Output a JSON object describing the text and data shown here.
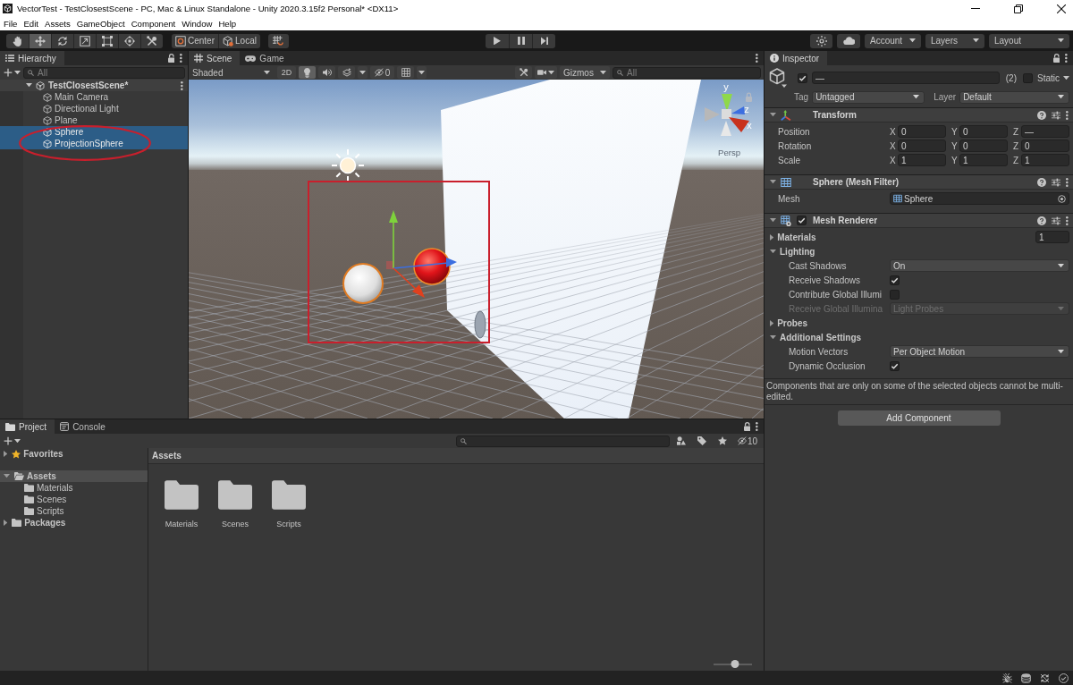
{
  "window": {
    "title": "VectorTest - TestClosestScene - PC, Mac & Linux Standalone - Unity 2020.3.15f2 Personal* <DX11>"
  },
  "menu": [
    "File",
    "Edit",
    "Assets",
    "GameObject",
    "Component",
    "Window",
    "Help"
  ],
  "toolbar": {
    "tools": [
      {
        "kind": "hand",
        "selected": false
      },
      {
        "kind": "move",
        "selected": true
      },
      {
        "kind": "rotate",
        "selected": false
      },
      {
        "kind": "scale",
        "selected": false
      },
      {
        "kind": "rect",
        "selected": false
      },
      {
        "kind": "transform",
        "selected": false
      },
      {
        "kind": "custom",
        "selected": false
      }
    ],
    "handles": [
      {
        "kind": "pivot",
        "label": "Center"
      },
      {
        "kind": "space",
        "label": "Local"
      }
    ],
    "menus": [
      "Account",
      "Layers",
      "Layout"
    ]
  },
  "hierarchy": {
    "tab": "Hierarchy",
    "search": {
      "placeholder": "All"
    },
    "scene": {
      "name": "TestClosestScene*",
      "expanded": true,
      "children": [
        {
          "name": "Main Camera",
          "selected": false
        },
        {
          "name": "Directional Light",
          "selected": false
        },
        {
          "name": "Plane",
          "selected": false
        },
        {
          "name": "Sphere",
          "selected": true
        },
        {
          "name": "ProjectionSphere",
          "selected": true
        }
      ]
    }
  },
  "scene_view": {
    "tabs": [
      {
        "kind": "scene",
        "label": "Scene",
        "selected": true
      },
      {
        "kind": "game",
        "label": "Game",
        "selected": false
      }
    ],
    "draw_mode": "Shaded",
    "mode_2d": {
      "label": "2D",
      "on": false
    },
    "toggles": [
      {
        "kind": "lighting",
        "on": true
      },
      {
        "kind": "audio",
        "on": false
      },
      {
        "kind": "effects",
        "on": false
      }
    ],
    "hidden_count": "0",
    "gizmos": "Gizmos",
    "search": {
      "placeholder": "All"
    },
    "axis_labels": [
      "y",
      "z",
      "x"
    ],
    "projection": "Persp"
  },
  "inspector": {
    "tab": "Inspector",
    "object": {
      "active": true,
      "name": "—",
      "count": "(2)",
      "static": false,
      "static_label": "Static",
      "tag_label": "Tag",
      "tag": "Untagged",
      "layer_label": "Layer",
      "layer": "Default"
    },
    "components": [
      {
        "kind": "transform",
        "title": "Transform",
        "expanded": true,
        "rows": [
          {
            "kind": "vector3",
            "label": "Position",
            "values": [
              {
                "axis": "X",
                "value": "0"
              },
              {
                "axis": "Y",
                "value": "0"
              },
              {
                "axis": "Z",
                "value": "—"
              }
            ]
          },
          {
            "kind": "vector3",
            "label": "Rotation",
            "values": [
              {
                "axis": "X",
                "value": "0"
              },
              {
                "axis": "Y",
                "value": "0"
              },
              {
                "axis": "Z",
                "value": "0"
              }
            ]
          },
          {
            "kind": "vector3",
            "label": "Scale",
            "values": [
              {
                "axis": "X",
                "value": "1"
              },
              {
                "axis": "Y",
                "value": "1"
              },
              {
                "axis": "Z",
                "value": "1"
              }
            ]
          }
        ]
      },
      {
        "kind": "mesh_filter",
        "title": "Sphere (Mesh Filter)",
        "expanded": true,
        "rows": [
          {
            "kind": "object",
            "label": "Mesh",
            "value": "Sphere"
          }
        ]
      },
      {
        "kind": "mesh_renderer",
        "title": "Mesh Renderer",
        "expanded": true,
        "enabled": true,
        "rows": [
          {
            "kind": "foldout",
            "label": "Materials",
            "expanded": false,
            "count": "1"
          },
          {
            "kind": "foldout",
            "label": "Lighting",
            "expanded": true,
            "rows": [
              {
                "kind": "dropdown",
                "label": "Cast Shadows",
                "value": "On",
                "disabled": false
              },
              {
                "kind": "checkbox",
                "label": "Receive Shadows",
                "checked": true,
                "disabled": false
              },
              {
                "kind": "checkbox",
                "label": "Contribute Global Illumi",
                "checked": false,
                "disabled": false
              },
              {
                "kind": "dropdown",
                "label": "Receive Global Illumina",
                "value": "Light Probes",
                "disabled": true
              }
            ]
          },
          {
            "kind": "foldout",
            "label": "Probes",
            "expanded": false
          },
          {
            "kind": "foldout",
            "label": "Additional Settings",
            "expanded": true,
            "rows": [
              {
                "kind": "dropdown",
                "label": "Motion Vectors",
                "value": "Per Object Motion",
                "disabled": false
              },
              {
                "kind": "checkbox",
                "label": "Dynamic Occlusion",
                "checked": true,
                "disabled": false
              }
            ]
          }
        ]
      }
    ],
    "note": "Components that are only on some of the selected objects cannot be multi-edited.",
    "add_button": "Add Component"
  },
  "project": {
    "tabs": [
      {
        "kind": "project",
        "label": "Project",
        "selected": true
      },
      {
        "kind": "console",
        "label": "Console",
        "selected": false
      }
    ],
    "hidden_count": "10",
    "tree": [
      {
        "kind": "favorites",
        "label": "Favorites",
        "expanded": false,
        "selected": false
      },
      {
        "kind": "folder",
        "label": "Assets",
        "expanded": true,
        "selected": true,
        "children": [
          {
            "kind": "folder",
            "label": "Materials",
            "selected": false
          },
          {
            "kind": "folder",
            "label": "Scenes",
            "selected": false
          },
          {
            "kind": "folder",
            "label": "Scripts",
            "selected": false
          }
        ]
      },
      {
        "kind": "folder",
        "label": "Packages",
        "expanded": false,
        "selected": false
      }
    ],
    "breadcrumb": "Assets",
    "items": [
      {
        "kind": "folder",
        "label": "Materials"
      },
      {
        "kind": "folder",
        "label": "Scenes"
      },
      {
        "kind": "folder",
        "label": "Scripts"
      }
    ],
    "icon_size": {
      "level": 0.55
    }
  }
}
